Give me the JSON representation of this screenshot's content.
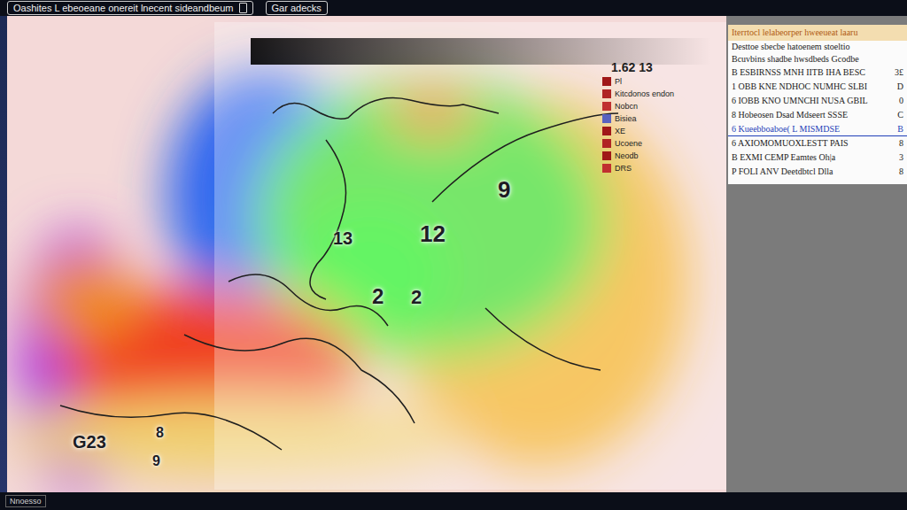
{
  "window": {
    "title": "Oashites L ebeoeane onereit lnecent sideandbeum",
    "tab": "Gar adecks"
  },
  "legend": {
    "title": "1.62 13",
    "items": [
      {
        "label": "Pl",
        "color": "#a01818"
      },
      {
        "label": "Kitcdonos endon",
        "color": "#b02424"
      },
      {
        "label": "Nobcn",
        "color": "#c03030"
      },
      {
        "label": "Bisiea",
        "color": "#5a62c0"
      },
      {
        "label": "XE",
        "color": "#a01818"
      },
      {
        "label": "Ucoene",
        "color": "#b02424"
      },
      {
        "label": "Neodb",
        "color": "#a01818"
      },
      {
        "label": "DRS",
        "color": "#c03030"
      }
    ]
  },
  "map_labels": [
    "9",
    "12",
    "13",
    "2",
    "2",
    "G23",
    "8",
    "9"
  ],
  "info_panel": {
    "title": "Iterrtocl lelabeorper hweeueat laaru",
    "lines": [
      "Desttoe sbecbe hatoenem stoeltio",
      "Bcuvbins shadbe hwsdbeds Gcodbe"
    ],
    "rows": [
      {
        "label": "B ESBIRNSS MNH IITB IHA BESC",
        "value": "3£",
        "selected": false
      },
      {
        "label": "1 OBB KNE NDHOC NUMHC SLBI",
        "value": "D",
        "selected": false
      },
      {
        "label": "6 IOBB KNO UMNCHI NUSA GBIL",
        "value": "0",
        "selected": false
      },
      {
        "label": "8 Hobeosen Dsad Mdseert SSSE",
        "value": "C",
        "selected": false
      },
      {
        "label": "6 Kueebboaboe( L MISMDSE",
        "value": "B",
        "selected": true
      },
      {
        "label": "6 AXIOMOMUOXLESTT PAIS",
        "value": "8",
        "selected": false
      },
      {
        "label": "B EXMI CEMP Eamtes Oh|a",
        "value": "3",
        "selected": false
      },
      {
        "label": "P FOLI ANV Deetdbtcl Dlla",
        "value": "8",
        "selected": false
      }
    ]
  },
  "status_bar": {
    "text": "Nnoesso"
  }
}
